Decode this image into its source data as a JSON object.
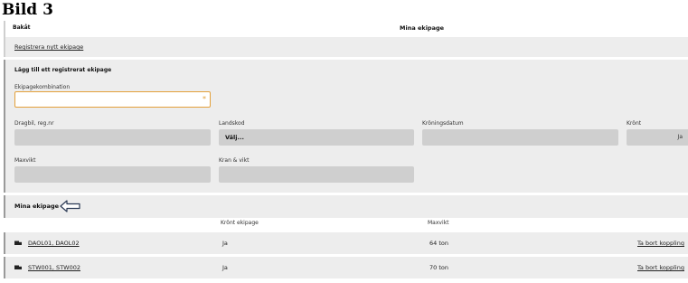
{
  "caption": "Bild 3",
  "header": {
    "back_label": "Bakåt",
    "title": "Mina ekipage"
  },
  "register": {
    "link_label": "Registrera nytt ekipage"
  },
  "form": {
    "title": "Lägg till ett registrerat ekipage",
    "combination": {
      "label": "Ekipagekombination",
      "value": "",
      "required_mark": "*"
    },
    "tractor": {
      "label": "Dragbil, reg.nr",
      "value": ""
    },
    "country": {
      "label": "Landskod",
      "value": "Välj..."
    },
    "coronation_date": {
      "label": "Kröningsdatum",
      "value": ""
    },
    "crowned": {
      "label": "Krönt",
      "value": "Ja"
    },
    "max_weight": {
      "label": "Maxvikt",
      "value": ""
    },
    "crane": {
      "label": "Kran & vikt",
      "value": ""
    }
  },
  "list": {
    "title": "Mina ekipage",
    "columns": {
      "crowned": "Krönt ekipage",
      "max_weight": "Maxvikt"
    },
    "rows": [
      {
        "name": "DAOL01, DAOL02",
        "crowned": "Ja",
        "max_weight": "64 ton",
        "action": "Ta bort koppling"
      },
      {
        "name": "STW001, STW002",
        "crowned": "Ja",
        "max_weight": "70 ton",
        "action": "Ta bort koppling"
      }
    ]
  },
  "icons": {
    "truck": "truck-icon",
    "arrow": "arrow-left-icon"
  },
  "colors": {
    "accent": "#e3a03a",
    "panel": "#ededed",
    "field": "#cfcfcf"
  }
}
